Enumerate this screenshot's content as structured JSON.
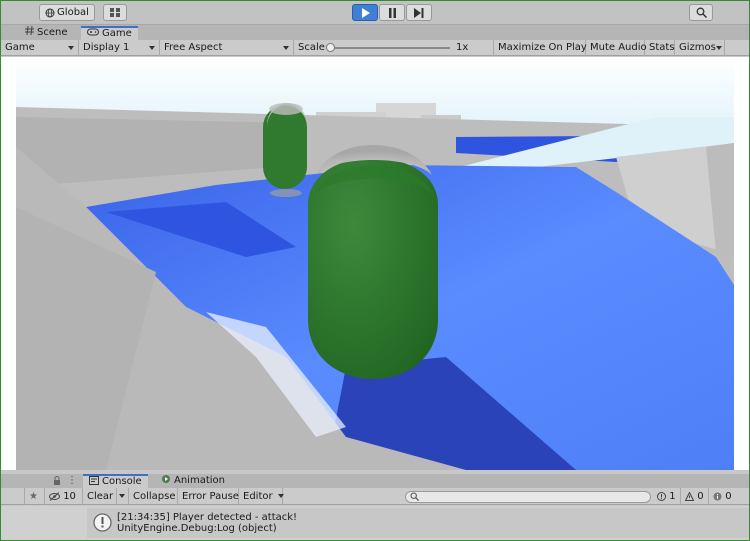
{
  "toolbar": {
    "global_label": "Global",
    "play_state": "playing"
  },
  "tabs": [
    {
      "label": "Scene"
    },
    {
      "label": "Game"
    }
  ],
  "gamebar": {
    "view_label": "Game",
    "display_label": "Display 1",
    "aspect_label": "Free Aspect",
    "scale_label": "Scale",
    "scale_value": "1x",
    "scale_slider_fraction": 0.0,
    "maximize_label": "Maximize On Play",
    "mute_label": "Mute Audio",
    "stats_label": "Stats",
    "gizmos_label": "Gizmos"
  },
  "console": {
    "tabs": [
      {
        "label": "Console"
      },
      {
        "label": "Animation"
      }
    ],
    "count_label": "10",
    "clear_label": "Clear",
    "collapse_label": "Collapse",
    "error_pause_label": "Error Pause",
    "editor_label": "Editor",
    "warn_count": "1",
    "error_count": "0",
    "info_count": "0",
    "log_line1": "[21:34:35] Player detected - attack!",
    "log_line2": "UnityEngine.Debug:Log (object)"
  },
  "colors": {
    "accent": "#3f7fd6",
    "capsule": "#2f7a2f",
    "water": "#4a78f0",
    "frame": "#2f8f2f"
  }
}
